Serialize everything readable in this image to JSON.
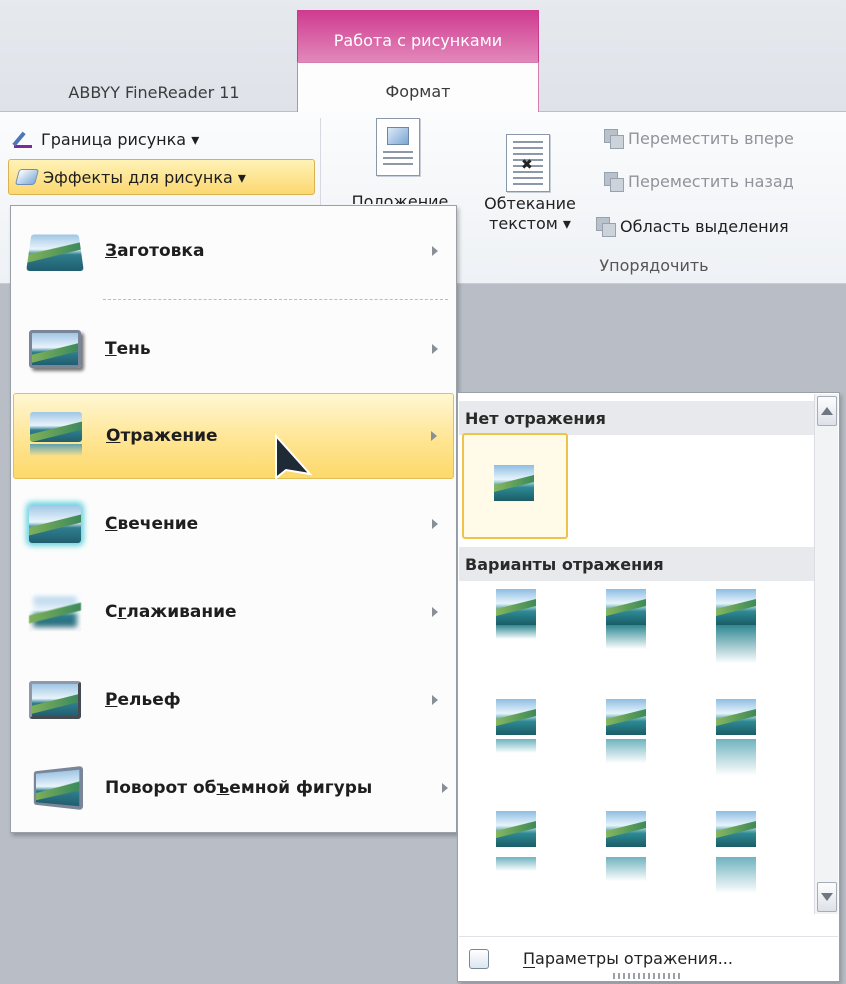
{
  "ribbon": {
    "context_group": "Работа с рисунками",
    "tabs": [
      "ABBYY FineReader 11",
      "Формат"
    ],
    "border_btn": "Граница рисунка ▾",
    "effects_btn": "Эффекты для рисунка ▾",
    "position_label_partial": "Положение",
    "wrap_label_line1": "Обтекание",
    "wrap_label_line2": "текстом ▾",
    "bring_forward": "Переместить впере",
    "send_backward": "Переместить назад",
    "selection_pane": "Область выделения",
    "arrange_group": "Упорядочить"
  },
  "effects_menu": {
    "items": [
      {
        "label": "Заготовка",
        "access": "З",
        "rest": "аготовка"
      },
      {
        "label": "Тень",
        "access": "Т",
        "rest": "ень"
      },
      {
        "label": "Отражение",
        "access": "О",
        "rest": "тражение"
      },
      {
        "label": "Свечение",
        "access": "С",
        "rest": "вечение"
      },
      {
        "label": "Сглаживание",
        "pre": "С",
        "access": "г",
        "rest": "лаживание"
      },
      {
        "label": "Рельеф",
        "access": "Р",
        "rest": "ельеф"
      },
      {
        "label": "Поворот объемной фигуры",
        "pre": "Поворот об",
        "access": "ъ",
        "rest": "емной фигуры"
      }
    ],
    "active_item": "Отражение"
  },
  "reflection_submenu": {
    "no_reflection_header": "Нет отражения",
    "variants_header": "Варианты отражения",
    "options_label": "Параметры отражения...",
    "options_access": "П",
    "options_rest": "араметры отражения..."
  },
  "colors": {
    "context_tab": "#d04a98",
    "highlight": "#fde38a",
    "selected_border": "#efc24a"
  }
}
